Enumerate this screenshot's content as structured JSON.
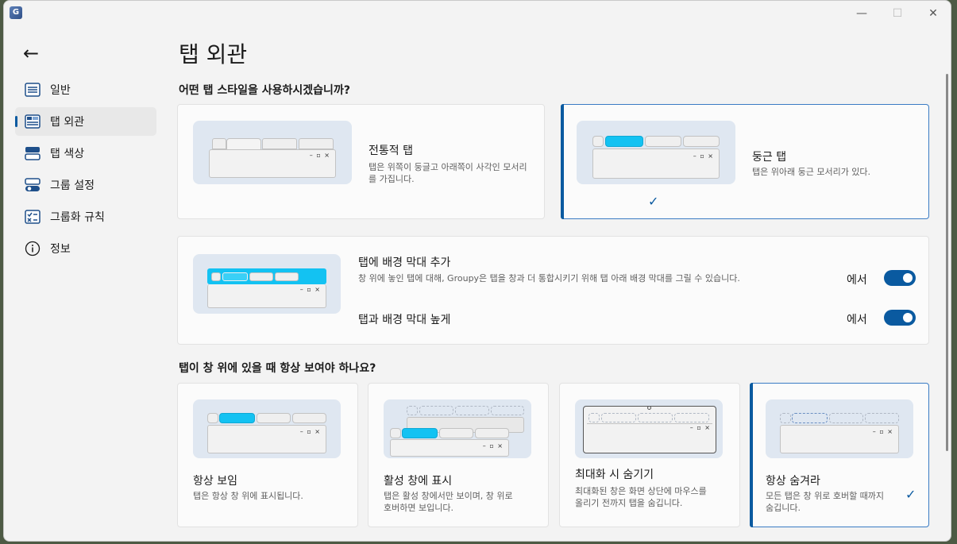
{
  "window": {
    "app_icon": "G",
    "minimize": "—",
    "maximize": "☐",
    "close": "✕"
  },
  "nav": {
    "back_icon": "←",
    "items": [
      {
        "label": "일반",
        "icon": "general-icon"
      },
      {
        "label": "탭 외관",
        "icon": "tab-appearance-icon",
        "active": true
      },
      {
        "label": "탭 색상",
        "icon": "tab-color-icon"
      },
      {
        "label": "그룹 설정",
        "icon": "group-settings-icon"
      },
      {
        "label": "그룹화 규칙",
        "icon": "grouping-rules-icon"
      },
      {
        "label": "정보",
        "icon": "info-icon"
      }
    ]
  },
  "page": {
    "title": "탭 외관"
  },
  "style_section": {
    "question": "어떤 탭 스타일을 사용하시겠습니까?",
    "options": [
      {
        "title": "전통적 탭",
        "desc": "탭은 위쪽이 둥글고 아래쪽이 사각인 모서리를 가집니다.",
        "selected": false
      },
      {
        "title": "둥근 탭",
        "desc": "탭은 위아래 둥근 모서리가 있다.",
        "selected": true
      }
    ],
    "check": "✓"
  },
  "background_bar": {
    "title": "탭에 배경 막대 추가",
    "desc": "창 위에 놓인 탭에 대해, Groupy은 탭을 창과 더 통합시키기 위해 탭 아래 배경 막대를 그릴 수 있습니다.",
    "toggle_label": "에서",
    "toggle_on": true,
    "height_title": "탭과 배경 막대 높게",
    "height_toggle_label": "에서",
    "height_toggle_on": true
  },
  "visibility_section": {
    "question": "탭이 창 위에 있을 때 항상 보여야 하나요?",
    "options": [
      {
        "title": "항상 보임",
        "desc": "탭은 항상 창 위에 표시됩니다.",
        "selected": false
      },
      {
        "title": "활성 창에 표시",
        "desc": "탭은 활성 창에서만 보이며, 창 위로 호버하면 보입니다.",
        "selected": false
      },
      {
        "title": "최대화 시 숨기기",
        "desc": "최대화된 창은 화면 상단에 마우스를 올리기 전까지 탭을 숨깁니다.",
        "selected": false
      },
      {
        "title": "항상 숨겨라",
        "desc": "모든 탭은 창 위로 호버할 때까지 숨깁니다.",
        "selected": true
      }
    ],
    "check": "✓"
  },
  "mock_controls": "– ▫ ×",
  "colors": {
    "accent": "#0a5aa0",
    "active_tab": "#13c2f2",
    "background": "#f3f3f3"
  }
}
